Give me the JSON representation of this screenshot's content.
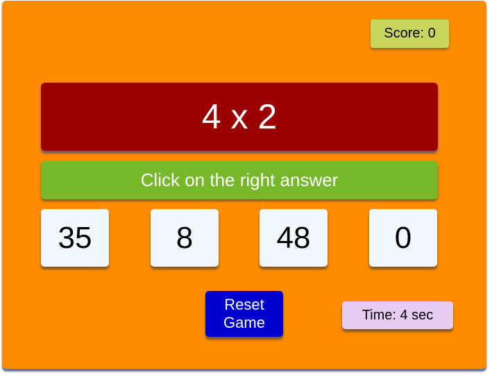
{
  "score": {
    "text": "Score: 0"
  },
  "question": {
    "text": "4 x 2"
  },
  "instruction": {
    "text": "Click on the right answer"
  },
  "choices": [
    "35",
    "8",
    "48",
    "0"
  ],
  "reset": {
    "line1": "Reset",
    "line2": "Game"
  },
  "time": {
    "text": "Time: 4 sec"
  },
  "colors": {
    "container": "#FF8C00",
    "score_bg": "#C8D65E",
    "question_bg": "#9B0000",
    "question_fg": "#FFFFFF",
    "instruction_bg": "#76B82A",
    "instruction_fg": "#FFFFFF",
    "choice_bg": "#F0F7FD",
    "choice_fg": "#000000",
    "reset_bg": "#0000CC",
    "reset_fg": "#FFFFFF",
    "time_bg": "#E6CCF0"
  }
}
